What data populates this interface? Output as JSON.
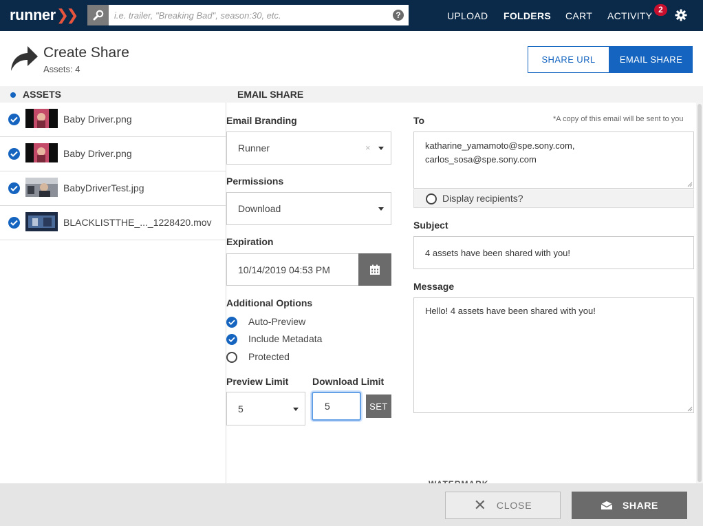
{
  "app": {
    "logo_text": "runner",
    "logo_mark": "»"
  },
  "search": {
    "placeholder": "i.e. trailer, \"Breaking Bad\", season:30, etc.",
    "help_glyph": "?"
  },
  "nav": {
    "upload": "UPLOAD",
    "folders": "FOLDERS",
    "cart": "CART",
    "activity": "ACTIVITY",
    "activity_badge": "2"
  },
  "header": {
    "title": "Create Share",
    "assets_count": "Assets: 4",
    "share_url_label": "SHARE URL",
    "email_share_label": "EMAIL SHARE"
  },
  "sections": {
    "assets": "ASSETS",
    "email_share": "EMAIL SHARE"
  },
  "assets": [
    {
      "name": "Baby Driver.png",
      "checked": true,
      "thumb": "pink"
    },
    {
      "name": "Baby Driver.png",
      "checked": true,
      "thumb": "pink"
    },
    {
      "name": "BabyDriverTest.jpg",
      "checked": true,
      "thumb": "car"
    },
    {
      "name": "BLACKLISTTHE_..._1228420.mov",
      "checked": true,
      "thumb": "blue"
    }
  ],
  "form": {
    "branding_label": "Email Branding",
    "branding_value": "Runner",
    "branding_clear": "×",
    "permissions_label": "Permissions",
    "permissions_value": "Download",
    "expiration_label": "Expiration",
    "expiration_value": "10/14/2019 04:53 PM",
    "options_label": "Additional Options",
    "options": [
      {
        "label": "Auto-Preview",
        "checked": true
      },
      {
        "label": "Include Metadata",
        "checked": true
      },
      {
        "label": "Protected",
        "checked": false
      }
    ],
    "preview_limit_label": "Preview Limit",
    "preview_limit_value": "5",
    "download_limit_label": "Download Limit",
    "download_limit_value": "5",
    "set_label": "SET"
  },
  "email": {
    "to_label": "To",
    "copy_note": "*A copy of this email will be sent to you",
    "recipients": [
      "katharine_yamamoto@spe.sony.com,",
      "carlos_sosa@spe.sony.com"
    ],
    "display_recipients_label": "Display recipients?",
    "subject_label": "Subject",
    "subject_value": "4 assets have been shared with you!",
    "message_label": "Message",
    "message_value": "Hello! 4 assets have been shared with you!",
    "next_section_peek": "WATERMARK"
  },
  "footer": {
    "close_label": "CLOSE",
    "share_label": "SHARE"
  },
  "colors": {
    "nav_bg": "#0b2a4a",
    "accent": "#1565c0",
    "brand_orange": "#e8553e",
    "badge": "#c8102e"
  }
}
